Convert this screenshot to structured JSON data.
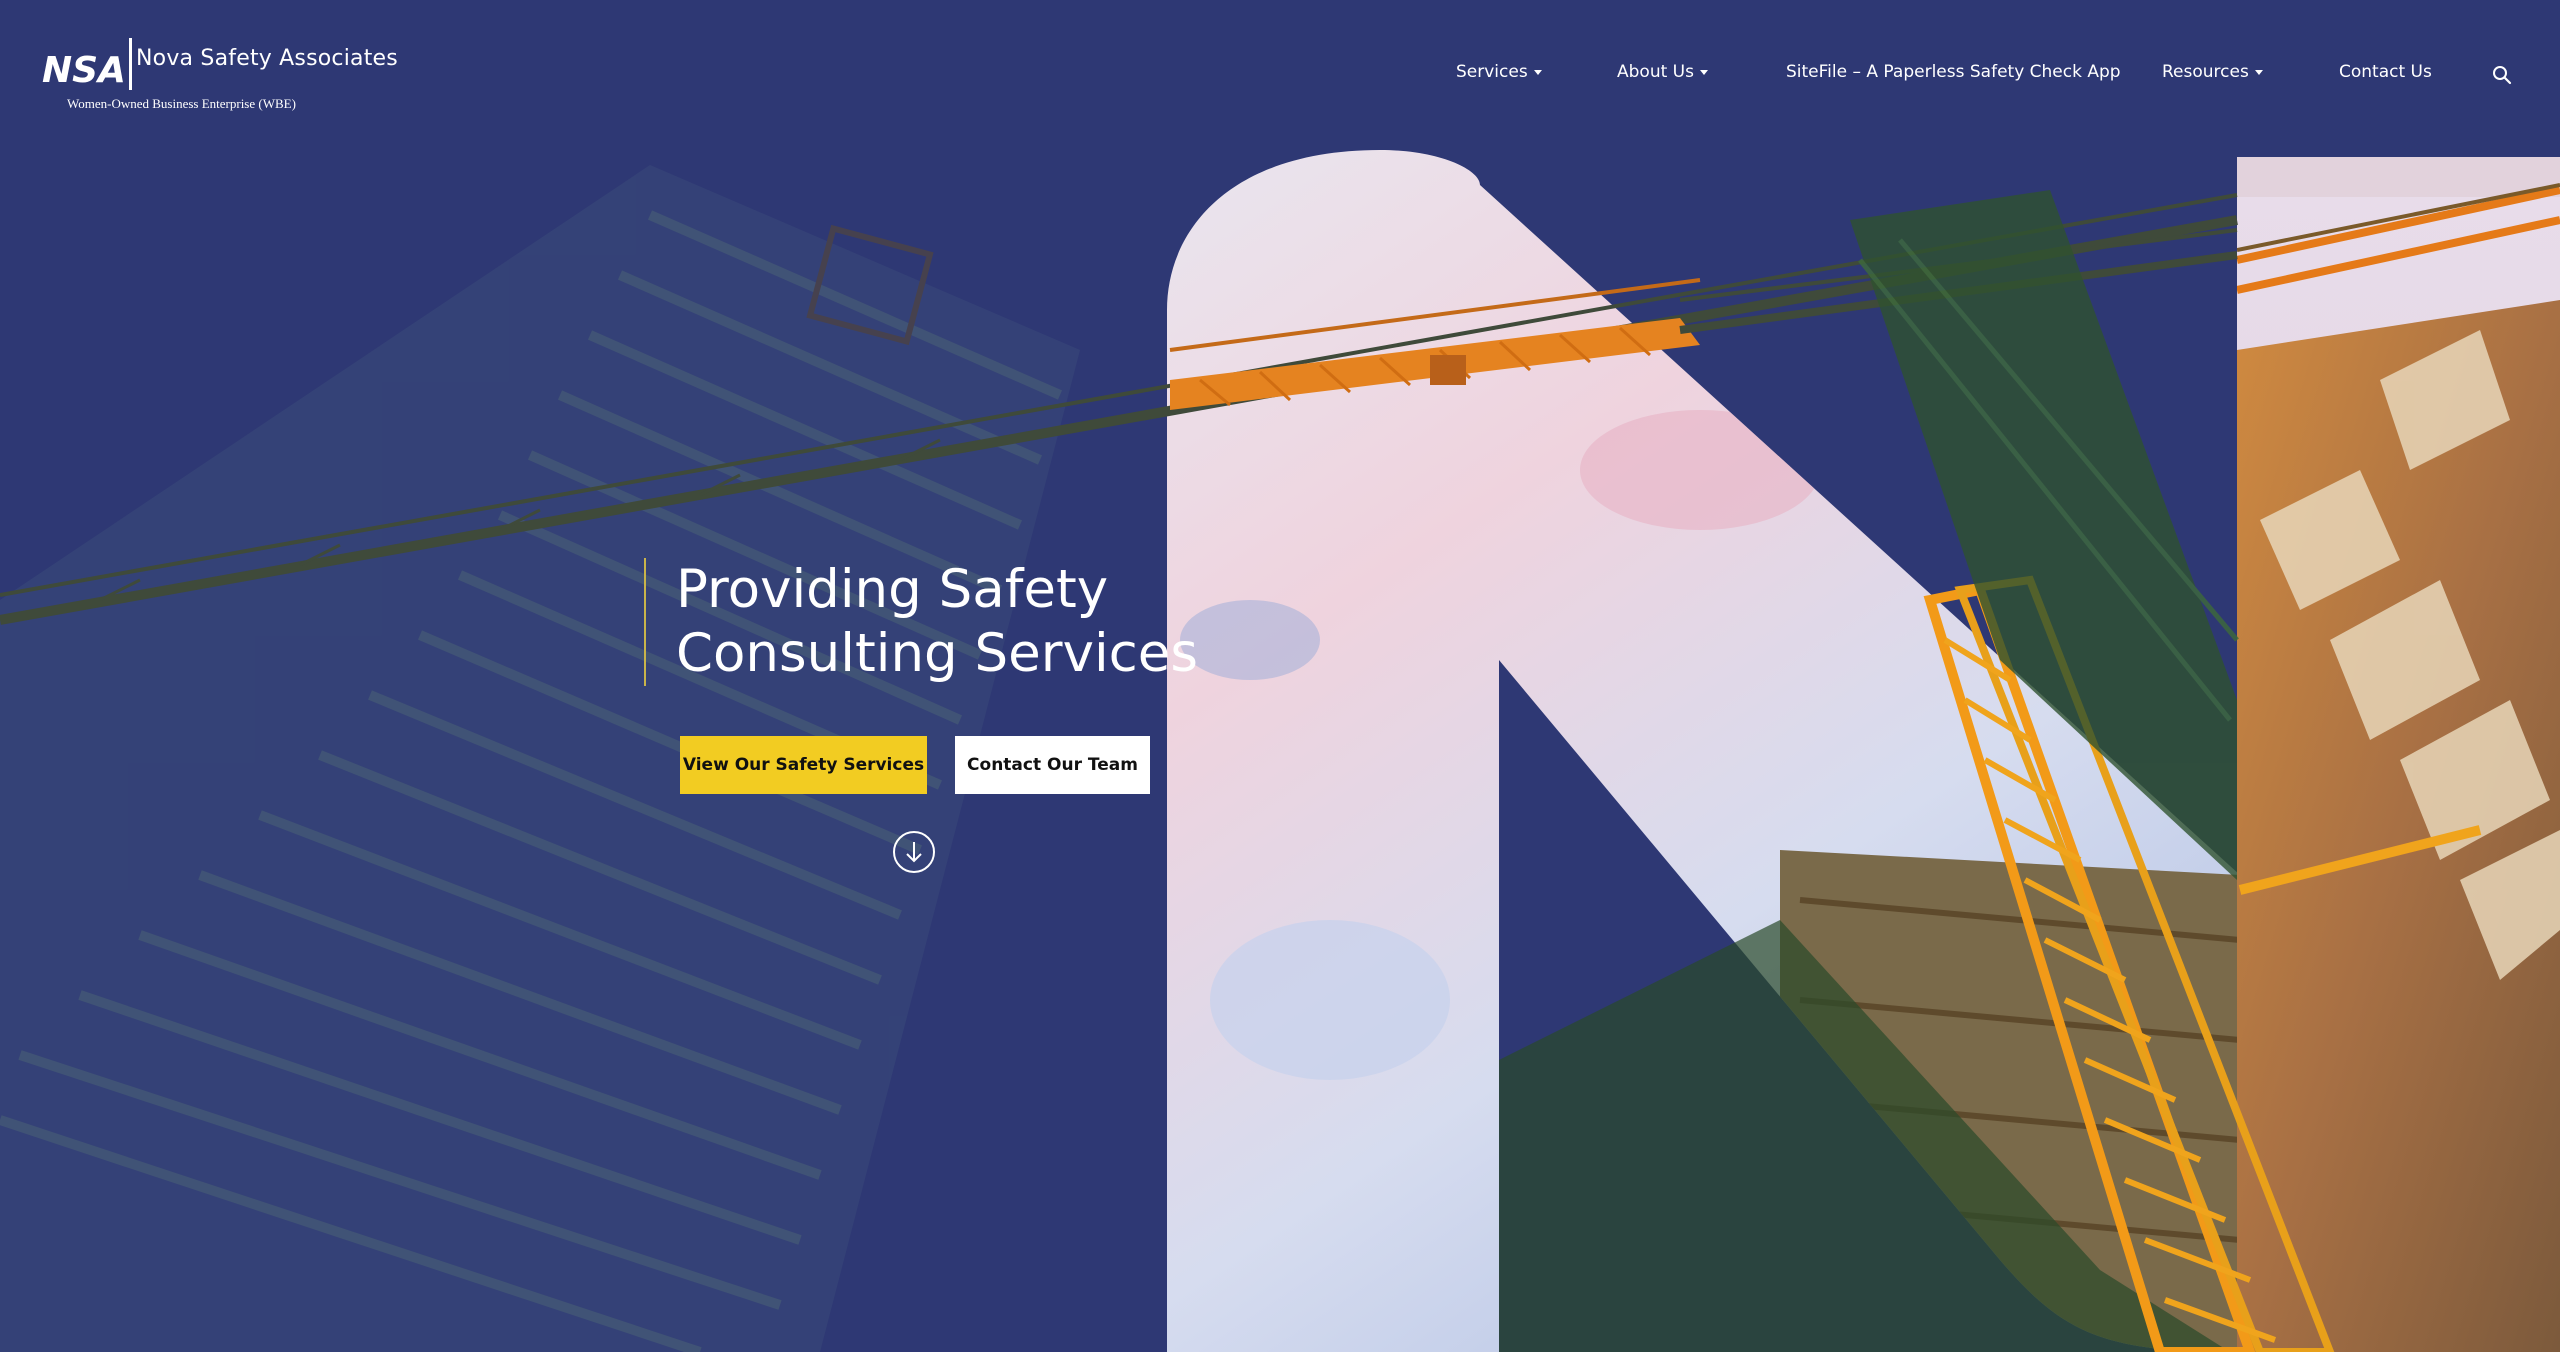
{
  "header": {
    "logo": {
      "mark_text": "NSA",
      "brand_name": "Nova Safety Associates",
      "tagline": "Women-Owned Business Enterprise (WBE)"
    },
    "nav": {
      "items": [
        {
          "label": "Services",
          "has_dropdown": true
        },
        {
          "label": "About Us",
          "has_dropdown": true
        },
        {
          "label": "SiteFile – A Paperless Safety Check App",
          "has_dropdown": false
        },
        {
          "label": "Resources",
          "has_dropdown": true
        },
        {
          "label": "Contact Us",
          "has_dropdown": false
        }
      ],
      "search_icon": "search-icon"
    }
  },
  "hero": {
    "headline_line1": "Providing Safety",
    "headline_line2": "Consulting Services",
    "primary_button": "View Our Safety Services",
    "secondary_button": "Contact Our Team",
    "scroll_icon": "arrow-down-circle-icon"
  },
  "colors": {
    "overlay": "#2e3874",
    "accent": "#f2cc22",
    "crane": "#f0861c"
  }
}
